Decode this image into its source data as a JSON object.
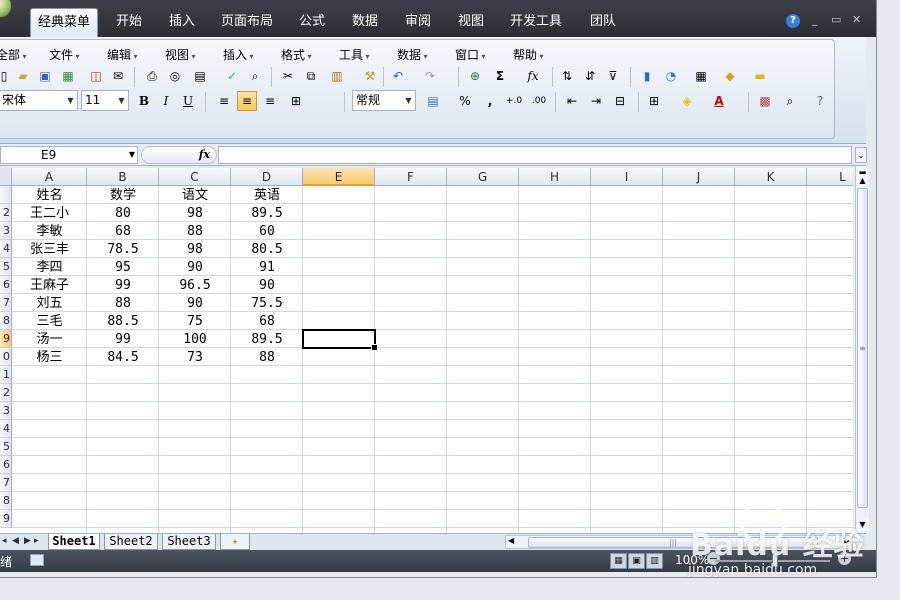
{
  "ribbon_tabs": [
    "经典菜单",
    "开始",
    "插入",
    "页面布局",
    "公式",
    "数据",
    "审阅",
    "视图",
    "开发工具",
    "团队"
  ],
  "window_controls": {
    "help": "?",
    "minimize": "_",
    "restore": "▭",
    "close": "✕"
  },
  "classic_menu": [
    "全部",
    "文件",
    "编辑",
    "视图",
    "插入",
    "格式",
    "工具",
    "数据",
    "窗口",
    "帮助"
  ],
  "toolbar": {
    "font_name": "宋体",
    "font_size": "11",
    "number_format": "常规",
    "bold": "B",
    "italic": "I",
    "underline": "U",
    "sum": "Σ",
    "fx": "fx",
    "percent": "%",
    "comma": ",",
    "inc_decimal": "+.0",
    "dec_decimal": ".00"
  },
  "formula_bar": {
    "name_box": "E9",
    "fx_label": "fx",
    "formula": ""
  },
  "columns": [
    "A",
    "B",
    "C",
    "D",
    "E",
    "F",
    "G",
    "H",
    "I",
    "J",
    "K",
    "L"
  ],
  "selected_column": "E",
  "rows": [
    "1",
    "2",
    "3",
    "4",
    "5",
    "6",
    "7",
    "8",
    "9",
    "10",
    "11",
    "12",
    "13",
    "14",
    "15",
    "16",
    "17",
    "18",
    "19"
  ],
  "row_labels_visible": [
    "",
    "2",
    "3",
    "4",
    "5",
    "6",
    "7",
    "8",
    "9",
    "0",
    "1",
    "2",
    "3",
    "4",
    "5",
    "6",
    "7",
    "8",
    "9"
  ],
  "selected_row": "9",
  "table": {
    "headers": [
      "姓名",
      "数学",
      "语文",
      "英语"
    ],
    "rows": [
      [
        "王二小",
        "80",
        "98",
        "89.5"
      ],
      [
        "李敏",
        "68",
        "88",
        "60"
      ],
      [
        "张三丰",
        "78.5",
        "98",
        "80.5"
      ],
      [
        "李四",
        "95",
        "90",
        "91"
      ],
      [
        "王麻子",
        "99",
        "96.5",
        "90"
      ],
      [
        "刘五",
        "88",
        "90",
        "75.5"
      ],
      [
        "三毛",
        "88.5",
        "75",
        "68"
      ],
      [
        "汤一",
        "99",
        "100",
        "89.5"
      ],
      [
        "杨三",
        "84.5",
        "73",
        "88"
      ]
    ]
  },
  "sheets": [
    "Sheet1",
    "Sheet2",
    "Sheet3"
  ],
  "active_sheet": "Sheet1",
  "status": {
    "text": "绪",
    "zoom": "100%"
  },
  "watermark": {
    "brand": "Baidu 经验",
    "url": "jingyan.baidu.com"
  },
  "colors": {
    "accent": "#f9c871",
    "ribbon_dark": "#2b2d33",
    "grid_line": "#d0d7e5"
  }
}
